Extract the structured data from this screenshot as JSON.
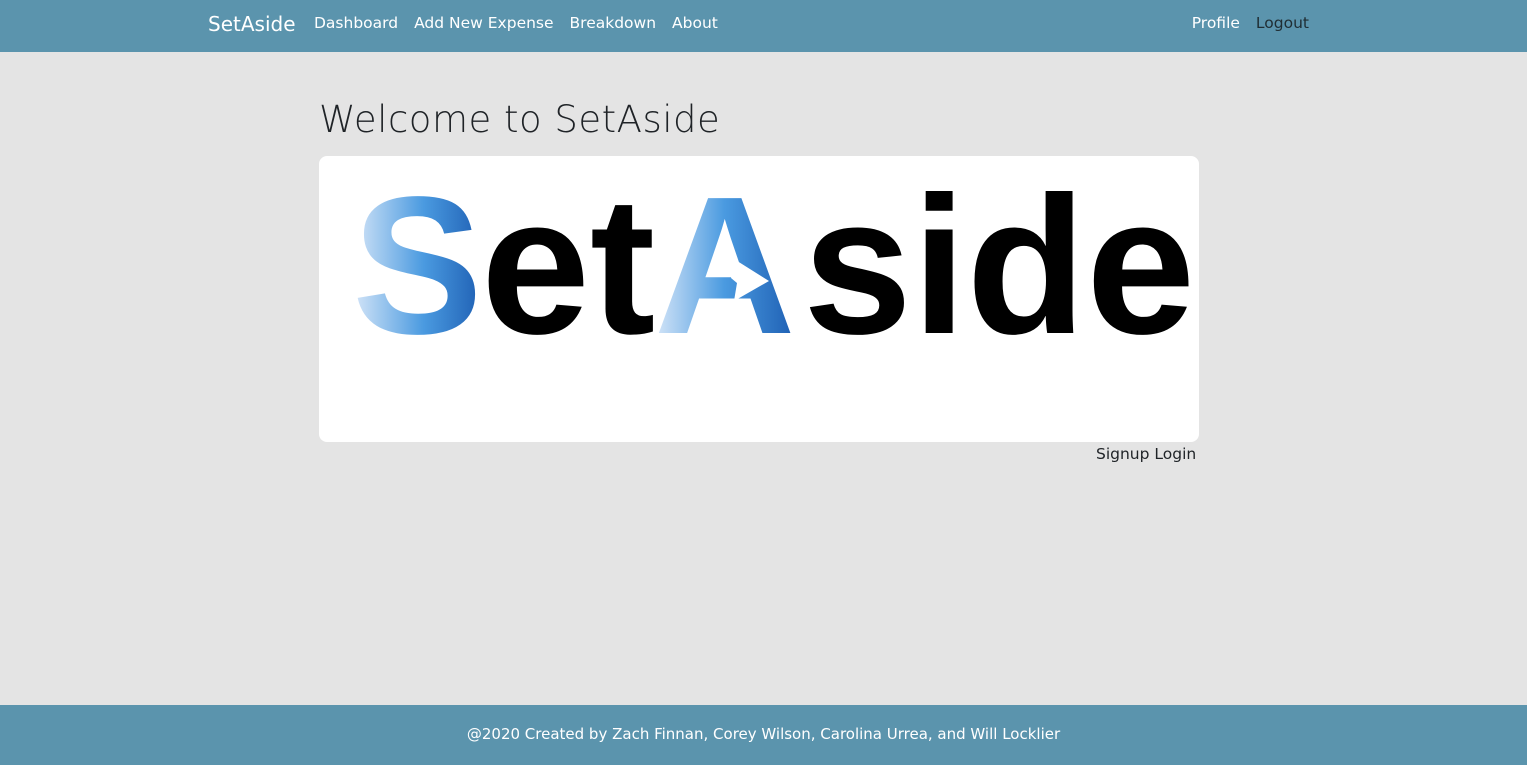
{
  "navbar": {
    "brand": "SetAside",
    "left_links": [
      "Dashboard",
      "Add New Expense",
      "Breakdown",
      "About"
    ],
    "right_links": [
      "Profile",
      "Logout"
    ]
  },
  "main": {
    "heading": "Welcome to SetAside",
    "logo": {
      "wordmark": "SetAside",
      "gradient_colors": [
        "#d6e6f8",
        "#4a9ae0",
        "#1e5fb3"
      ],
      "text_color": "#000000"
    },
    "auth": {
      "signup_label": "Signup",
      "login_label": "Login"
    }
  },
  "footer": {
    "text": "@2020 Created by Zach Finnan, Corey Wilson, Carolina Urrea, and Will Locklier"
  },
  "colors": {
    "navbar_bg": "#5b94ad",
    "page_bg": "#e4e4e4",
    "card_bg": "#ffffff"
  }
}
